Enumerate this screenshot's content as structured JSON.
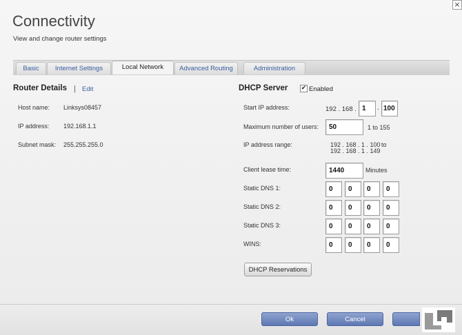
{
  "window": {
    "close_glyph": "×"
  },
  "header": {
    "title": "Connectivity",
    "subtitle": "View and change router settings"
  },
  "tabs": [
    {
      "label": "Basic",
      "active": false
    },
    {
      "label": "Internet Settings",
      "active": false
    },
    {
      "label": "Local Network",
      "active": true
    },
    {
      "label": "Advanced Routing",
      "active": false
    },
    {
      "label": "Administration",
      "active": false
    }
  ],
  "router_details": {
    "title": "Router Details",
    "separator": "|",
    "edit_label": "Edit",
    "host_name_label": "Host name:",
    "host_name": "Linksys08457",
    "ip_address_label": "IP address:",
    "ip_address": "192.168.1.1",
    "subnet_mask_label": "Subnet mask:",
    "subnet_mask": "255.255.255.0"
  },
  "dhcp": {
    "title": "DHCP Server",
    "enabled_label": "Enabled",
    "enabled_checked": true,
    "check_glyph": "✔",
    "start_ip_label": "Start IP address:",
    "start_ip_prefix": "192 . 168 .",
    "start_ip_octet3": "1",
    "start_ip_octet4": "100",
    "max_users_label": "Maximum number of users:",
    "max_users": "50",
    "max_users_hint": "1 to 155",
    "range_label": "IP address range:",
    "range_from": "192 . 168 . 1 . 100",
    "range_to_word": "to",
    "range_to": "192 . 168 . 1 . 149",
    "lease_label": "Client lease time:",
    "lease_value": "1440",
    "lease_unit": "Minutes",
    "dns1_label": "Static DNS 1:",
    "dns2_label": "Static DNS 2:",
    "dns3_label": "Static DNS 3:",
    "wins_label": "WINS:",
    "dns1": [
      "0",
      "0",
      "0",
      "0"
    ],
    "dns2": [
      "0",
      "0",
      "0",
      "0"
    ],
    "dns3": [
      "0",
      "0",
      "0",
      "0"
    ],
    "wins": [
      "0",
      "0",
      "0",
      "0"
    ],
    "reservations_label": "DHCP Reservations"
  },
  "footer": {
    "ok_label": "Ok",
    "cancel_label": "Cancel"
  },
  "colors": {
    "link": "#3a5fa0",
    "button_blue": "#5f78b4"
  }
}
